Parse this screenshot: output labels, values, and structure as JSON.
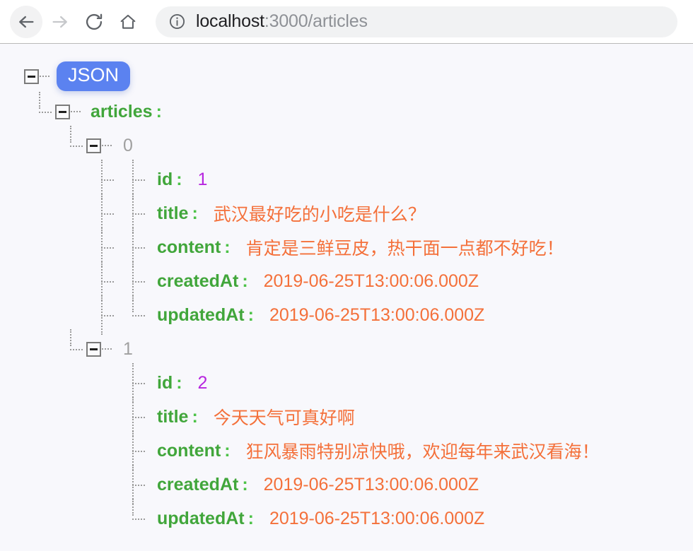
{
  "browser": {
    "back_label": "Back",
    "forward_label": "Forward",
    "reload_label": "Reload",
    "home_label": "Home",
    "site_info_label": "View site information",
    "url_host": "localhost",
    "url_rest": ":3000/articles",
    "url_full": "localhost:3000/articles"
  },
  "viewer": {
    "root_badge": "JSON",
    "root_key": "articles",
    "colon": ":",
    "collapse_symbol": "−",
    "items": [
      {
        "index": "0",
        "fields": [
          {
            "key": "id",
            "value": "1",
            "type": "num"
          },
          {
            "key": "title",
            "value": "武汉最好吃的小吃是什么？",
            "type": "str"
          },
          {
            "key": "content",
            "value": "肯定是三鲜豆皮，热干面一点都不好吃！",
            "type": "str"
          },
          {
            "key": "createdAt",
            "value": "2019-06-25T13:00:06.000Z",
            "type": "date"
          },
          {
            "key": "updatedAt",
            "value": "2019-06-25T13:00:06.000Z",
            "type": "date"
          }
        ]
      },
      {
        "index": "1",
        "fields": [
          {
            "key": "id",
            "value": "2",
            "type": "num"
          },
          {
            "key": "title",
            "value": "今天天气可真好啊",
            "type": "str"
          },
          {
            "key": "content",
            "value": "狂风暴雨特别凉快哦，欢迎每年来武汉看海！",
            "type": "str"
          },
          {
            "key": "createdAt",
            "value": "2019-06-25T13:00:06.000Z",
            "type": "date"
          },
          {
            "key": "updatedAt",
            "value": "2019-06-25T13:00:06.000Z",
            "type": "date"
          }
        ]
      }
    ]
  },
  "colors": {
    "badge": "#5b82f0",
    "key": "#41a63b",
    "string": "#f4703a",
    "number": "#b726df",
    "index": "#a0a0a0",
    "background": "#f8f8fc"
  }
}
